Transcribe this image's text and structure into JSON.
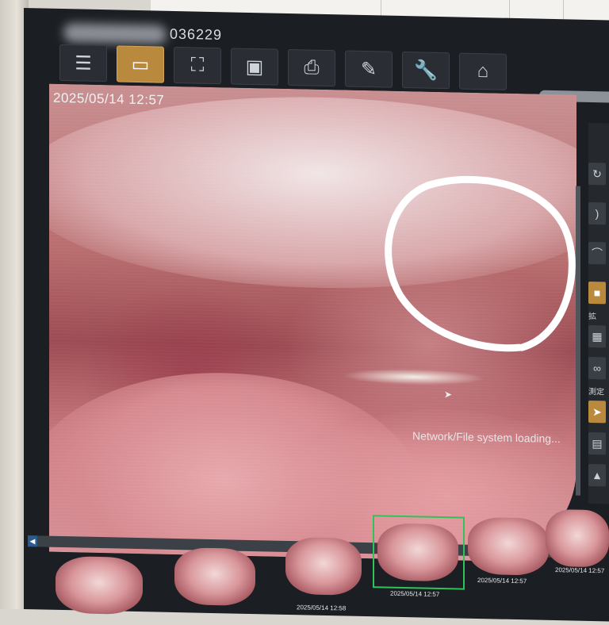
{
  "header": {
    "patient_id_suffix": "036229"
  },
  "toolbar": {
    "items": [
      {
        "name": "list-view",
        "glyph": "☰"
      },
      {
        "name": "image-gallery",
        "glyph": "▭"
      },
      {
        "name": "recorder",
        "glyph": "⛶"
      },
      {
        "name": "camera",
        "glyph": "▣"
      },
      {
        "name": "printer",
        "glyph": "⎙"
      },
      {
        "name": "report",
        "glyph": "✎"
      },
      {
        "name": "settings-wrench",
        "glyph": "🔧"
      },
      {
        "name": "home",
        "glyph": "⌂"
      }
    ],
    "active_index": 1
  },
  "viewer": {
    "timestamp": "2025/05/14 12:57",
    "status": "Network/File system loading..."
  },
  "side_panel": {
    "labels": [
      "拡",
      "測定"
    ]
  },
  "thumbnails": {
    "top_row": [
      {
        "date": ""
      },
      {
        "date": "2025/05/14 12:57"
      },
      {
        "date": "2025/05/14 12:57"
      },
      {
        "date": "2025/05/14 12:57"
      }
    ],
    "bottom_row": [
      {
        "date": ""
      },
      {
        "date": ""
      },
      {
        "date": "2025/05/14 12:58"
      }
    ],
    "selected_index": 1
  },
  "colors": {
    "accent": "#b9893e",
    "selection": "#31c25a",
    "annotation": "#ffffff"
  }
}
